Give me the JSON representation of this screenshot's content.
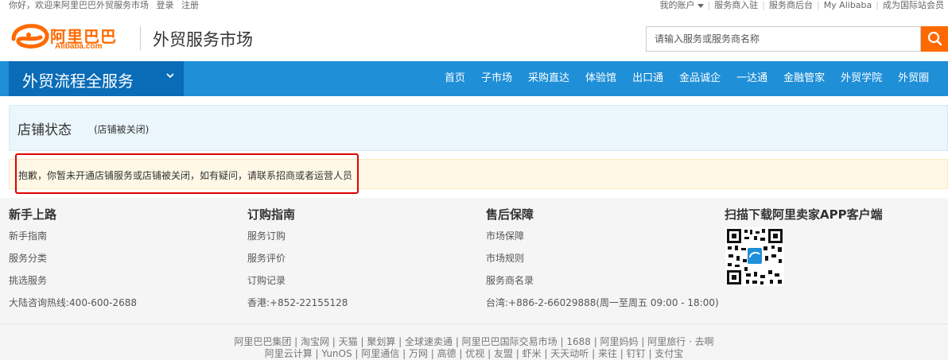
{
  "topbar": {
    "greeting": "你好，欢迎来阿里巴巴外贸服务市场",
    "login": "登录",
    "register": "注册",
    "my_account": "我的账户",
    "provider_join": "服务商入驻",
    "provider_backend": "服务商后台",
    "my_alibaba": "My Alibaba",
    "intl_station": "成为国际站会员"
  },
  "header": {
    "logo_cn": "阿里巴巴",
    "logo_en": "Alibaba.com",
    "site_name": "外贸服务市场",
    "search_placeholder": "请输入服务或服务商名称",
    "brand_color": "#ff6a00"
  },
  "nav": {
    "category_label": "外贸流程全服务",
    "items": [
      "首页",
      "子市场",
      "采购直达",
      "体验馆",
      "出口通",
      "金品诚企",
      "一达通",
      "金融管家",
      "外贸学院",
      "外贸圈"
    ]
  },
  "content": {
    "store_status_title": "店铺状态",
    "store_status_note": "(店铺被关闭)",
    "notice": "抱歉，你暂未开通店铺服务或店铺被关闭，如有疑问，请联系招商或者运营人员"
  },
  "footer": {
    "columns": [
      {
        "title": "新手上路",
        "items": [
          "新手指南",
          "服务分类",
          "挑选服务",
          "大陆咨询热线:400-600-2688"
        ]
      },
      {
        "title": "订购指南",
        "items": [
          "服务订购",
          "服务评价",
          "订购记录",
          "香港:+852-22155128"
        ]
      },
      {
        "title": "售后保障",
        "items": [
          "市场保障",
          "市场规则",
          "服务商名录",
          "台湾:+886-2-66029888(周一至周五 09:00 - 18:00)"
        ]
      },
      {
        "title": "扫描下载阿里卖家APP客户端",
        "items": []
      }
    ],
    "links_line1": "阿里巴巴集团 | 淘宝网 | 天猫 | 聚划算 | 全球速卖通 | 阿里巴巴国际交易市场 | 1688 | 阿里妈妈 | 阿里旅行 · 去啊",
    "links_line2": "阿里云计算 | YunOS | 阿里通信 | 万网 | 高德 | 优视 | 友盟 | 虾米 | 天天动听 | 来往 | 钉钉 | 支付宝"
  }
}
